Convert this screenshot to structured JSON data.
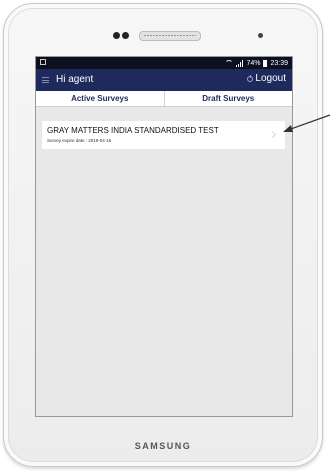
{
  "status_bar": {
    "battery": "74%",
    "time": "23:39"
  },
  "header": {
    "greeting": "Hi agent",
    "logout_label": "Logout"
  },
  "tabs": [
    {
      "label": "Active Surveys"
    },
    {
      "label": "Draft Surveys"
    }
  ],
  "surveys": [
    {
      "title": "GRAY MATTERS INDIA STANDARDISED TEST",
      "expire": "Survey expire date : 2019-04-16"
    }
  ],
  "device": {
    "brand": "SAMSUNG"
  },
  "colors": {
    "header_bg": "#1e2a5c",
    "status_bg": "#0b0f1f",
    "content_bg": "#e8e8e8",
    "tab_text": "#1e2a5c"
  },
  "icons": [
    "menu-icon",
    "wifi-icon",
    "signal-icon",
    "battery-icon",
    "power-icon",
    "chevron-right-icon",
    "pointer-arrow-icon"
  ]
}
